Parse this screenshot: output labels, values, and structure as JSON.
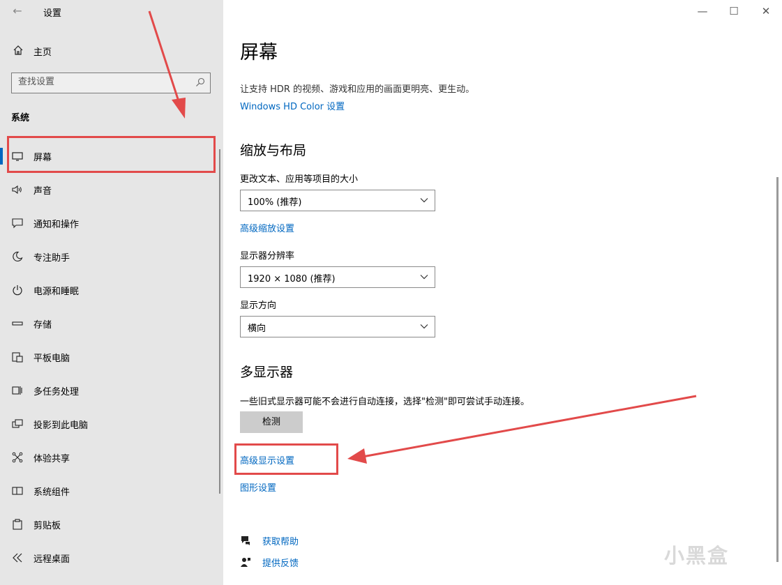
{
  "window": {
    "title": "设置"
  },
  "sidebar": {
    "home_label": "主页",
    "search_placeholder": "查找设置",
    "section_label": "系统",
    "items": [
      {
        "label": "屏幕",
        "icon": "monitor-icon",
        "active": true
      },
      {
        "label": "声音",
        "icon": "speaker-icon"
      },
      {
        "label": "通知和操作",
        "icon": "notification-icon"
      },
      {
        "label": "专注助手",
        "icon": "moon-icon"
      },
      {
        "label": "电源和睡眠",
        "icon": "power-icon"
      },
      {
        "label": "存储",
        "icon": "storage-icon"
      },
      {
        "label": "平板电脑",
        "icon": "tablet-icon"
      },
      {
        "label": "多任务处理",
        "icon": "multitask-icon"
      },
      {
        "label": "投影到此电脑",
        "icon": "project-icon"
      },
      {
        "label": "体验共享",
        "icon": "share-icon"
      },
      {
        "label": "系统组件",
        "icon": "components-icon"
      },
      {
        "label": "剪贴板",
        "icon": "clipboard-icon"
      },
      {
        "label": "远程桌面",
        "icon": "remote-desktop-icon"
      }
    ]
  },
  "main": {
    "title": "屏幕",
    "hdr_text": "让支持 HDR 的视频、游戏和应用的画面更明亮、更生动。",
    "hdr_link": "Windows HD Color 设置",
    "scale_heading": "缩放与布局",
    "scale_label": "更改文本、应用等项目的大小",
    "scale_value": "100% (推荐)",
    "advanced_scale_link": "高级缩放设置",
    "resolution_label": "显示器分辨率",
    "resolution_value": "1920 × 1080 (推荐)",
    "orientation_label": "显示方向",
    "orientation_value": "横向",
    "multi_heading": "多显示器",
    "multi_text": "一些旧式显示器可能不会进行自动连接，选择\"检测\"即可尝试手动连接。",
    "detect_button": "检测",
    "advanced_display_link": "高级显示设置",
    "graphics_link": "图形设置",
    "help_link": "获取帮助",
    "feedback_link": "提供反馈"
  },
  "watermark": "小黑盒",
  "colors": {
    "accent": "#0067c0",
    "annotation_red": "#e24a4a",
    "sidebar_bg": "#e6e6e6"
  }
}
